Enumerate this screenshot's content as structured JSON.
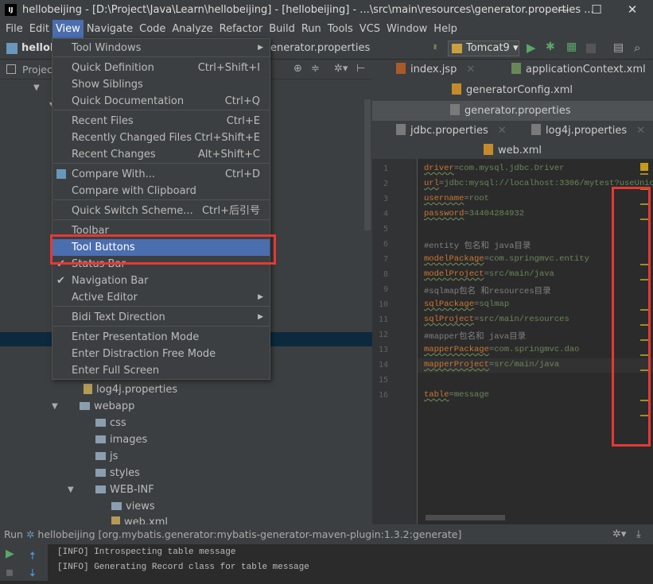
{
  "window": {
    "title": "hellobeijing - [D:\\Project\\Java\\Learn\\hellobeijing] - [hellobeijing] - ...\\src\\main\\resources\\generator.properties ...",
    "logo": "IJ",
    "minimize": "—",
    "maximize": "☐",
    "close": "✕"
  },
  "menubar": [
    "File",
    "Edit",
    "View",
    "Navigate",
    "Code",
    "Analyze",
    "Refactor",
    "Build",
    "Run",
    "Tools",
    "VCS",
    "Window",
    "Help"
  ],
  "navbar": {
    "project": "hellob",
    "file": "enerator.properties",
    "run_config": "Tomcat9"
  },
  "project_panel": {
    "label": "Project"
  },
  "tree": [
    {
      "label": "log4j.properties",
      "type": "file"
    },
    {
      "label": "webapp",
      "type": "folder"
    },
    {
      "label": "css",
      "type": "folder"
    },
    {
      "label": "images",
      "type": "folder"
    },
    {
      "label": "js",
      "type": "folder"
    },
    {
      "label": "styles",
      "type": "folder"
    },
    {
      "label": "WEB-INF",
      "type": "folder"
    },
    {
      "label": "views",
      "type": "folder"
    },
    {
      "label": "web.xml",
      "type": "file"
    }
  ],
  "tabs": [
    {
      "label": "index.jsp"
    },
    {
      "label": "applicationContext.xml"
    },
    {
      "label": "generatorConfig.xml"
    },
    {
      "label": "generator.properties",
      "active": true
    },
    {
      "label": "jdbc.properties"
    },
    {
      "label": "log4j.properties"
    },
    {
      "label": "web.xml"
    }
  ],
  "view_menu": [
    {
      "label": "Tool Windows",
      "submenu": true
    },
    {
      "label": "Quick Definition",
      "shortcut": "Ctrl+Shift+I"
    },
    {
      "label": "Show Siblings"
    },
    {
      "label": "Quick Documentation",
      "shortcut": "Ctrl+Q"
    },
    {
      "label": "Recent Files",
      "shortcut": "Ctrl+E"
    },
    {
      "label": "Recently Changed Files",
      "shortcut": "Ctrl+Shift+E"
    },
    {
      "label": "Recent Changes",
      "shortcut": "Alt+Shift+C"
    },
    {
      "label": "Compare With...",
      "shortcut": "Ctrl+D"
    },
    {
      "label": "Compare with Clipboard"
    },
    {
      "label": "Quick Switch Scheme...",
      "shortcut": "Ctrl+后引号"
    },
    {
      "label": "Toolbar"
    },
    {
      "label": "Tool Buttons",
      "highlighted": true
    },
    {
      "label": "Status Bar",
      "checked": true
    },
    {
      "label": "Navigation Bar",
      "checked": true
    },
    {
      "label": "Active Editor",
      "submenu": true
    },
    {
      "label": "Bidi Text Direction",
      "submenu": true
    },
    {
      "label": "Enter Presentation Mode"
    },
    {
      "label": "Enter Distraction Free Mode"
    },
    {
      "label": "Enter Full Screen"
    }
  ],
  "editor": {
    "lines": [
      {
        "n": "1",
        "key": "driver",
        "val": "com.mysql.jdbc.Driver"
      },
      {
        "n": "2",
        "key": "url",
        "val": "jdbc:mysql://localhost:3306/mytest?useUnico"
      },
      {
        "n": "3",
        "key": "username",
        "val": "root"
      },
      {
        "n": "4",
        "key": "password",
        "val": "34404284932"
      },
      {
        "n": "5"
      },
      {
        "n": "6",
        "comment": "#entity 包名和 java目录"
      },
      {
        "n": "7",
        "key": "modelPackage",
        "val": "com.springmvc.entity"
      },
      {
        "n": "8",
        "key": "modelProject",
        "val": "src/main/java"
      },
      {
        "n": "9",
        "comment": "#sqlmap包名 和resources目录"
      },
      {
        "n": "10",
        "key": "sqlPackage",
        "val": "sqlmap"
      },
      {
        "n": "11",
        "key": "sqlProject",
        "val": "src/main/resources"
      },
      {
        "n": "12",
        "comment": "#mapper包名和 java目录"
      },
      {
        "n": "13",
        "key": "mapperPackage",
        "val": "com.springmvc.dao"
      },
      {
        "n": "14",
        "key": "mapperProject",
        "val": "src/main/java"
      },
      {
        "n": "15"
      },
      {
        "n": "16",
        "key": "table",
        "val": "message"
      }
    ]
  },
  "run": {
    "label": "Run",
    "config": "hellobeijing [org.mybatis.generator:mybatis-generator-maven-plugin:1.3.2:generate]"
  },
  "console": [
    "[INFO] Introspecting table message",
    "[INFO] Generating Record class for table message"
  ],
  "colors": {
    "highlight": "#4b6eaf",
    "annotation_red": "#e53935",
    "panel": "#3c3f41",
    "editor": "#2b2b2b"
  }
}
